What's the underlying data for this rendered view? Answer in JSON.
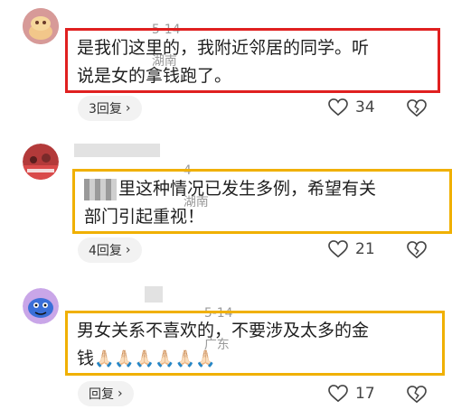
{
  "comments": [
    {
      "date": "5-14",
      "location": "湖南",
      "text_line1": "是我们这里的，我附近邻居的同学。听",
      "text_line2": "说是女的拿钱跑了。",
      "reply_label": "3回复",
      "likes": "34",
      "highlight_color": "#e02020"
    },
    {
      "date": "4",
      "location": "湖南",
      "text_line1_masked": "里这种情况已发生多例，希望有关",
      "text_line2": "部门引起重视！",
      "reply_label": "4回复",
      "likes": "21",
      "highlight_color": "#f0b000"
    },
    {
      "date": "5-14",
      "location": "广东",
      "text_line1": "男女关系不喜欢的，不要涉及太多的金",
      "text_line2": "钱",
      "emoji": "🙏🏻🙏🏻🙏🏻🙏🏻🙏🏻🙏🏻",
      "reply_label": "回复",
      "likes": "17",
      "highlight_color": "#f0b000"
    }
  ],
  "icons": {
    "like": "heart-outline-icon",
    "dislike": "broken-heart-icon",
    "chevron": "chevron-right-icon"
  }
}
